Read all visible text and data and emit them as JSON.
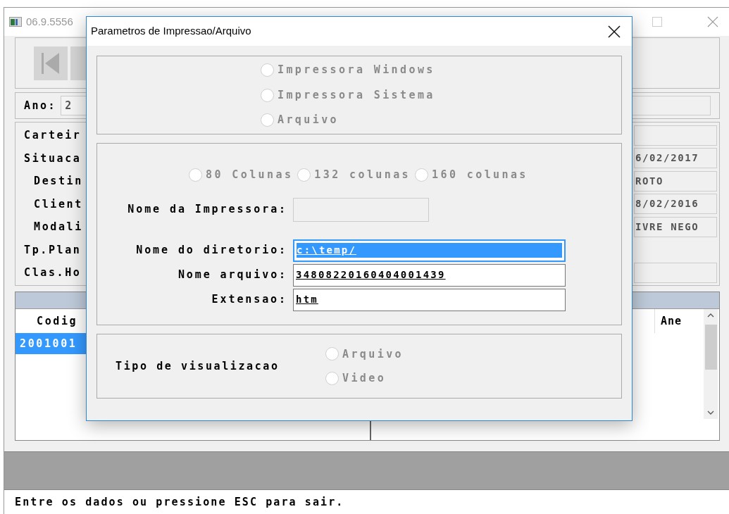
{
  "window": {
    "title": "06.9.5556"
  },
  "year": {
    "label": "Ano:",
    "value": "2"
  },
  "info_rows": [
    {
      "label": "Carteir",
      "field": true
    },
    {
      "label": "Situaca",
      "field": true,
      "value": "6/02/2017"
    },
    {
      "label": "Destin",
      "field": true,
      "value": "ROTO"
    },
    {
      "label": "Client",
      "field": true,
      "value": "8/02/2016"
    },
    {
      "label": "Modali",
      "field": true,
      "value": "IVRE NEGO"
    },
    {
      "label": "Tp.Plan",
      "field": false
    },
    {
      "label": "Clas.Ho",
      "field": true
    }
  ],
  "table": {
    "columns": [
      "Codig",
      "Ane"
    ],
    "rows": [
      {
        "cells": [
          "2001001"
        ],
        "selected": true
      }
    ]
  },
  "status_bar": "Entre os dados ou pressione ESC para sair.",
  "dialog": {
    "title": "Parametros de Impressao/Arquivo",
    "destination": [
      {
        "label": "Impressora Windows",
        "selected": false,
        "disabled": true
      },
      {
        "label": "Impressora Sistema",
        "selected": false,
        "disabled": true
      },
      {
        "label": "Arquivo",
        "selected": false,
        "disabled": true
      }
    ],
    "columns": [
      {
        "label": "80 Colunas",
        "selected": false,
        "disabled": true
      },
      {
        "label": "132 colunas",
        "selected": false,
        "disabled": true
      },
      {
        "label": "160 colunas",
        "selected": false,
        "disabled": true
      }
    ],
    "fields": [
      {
        "label": "Nome da Impressora:",
        "kind": "short",
        "disabled": true,
        "selected": false
      },
      {
        "label": "Nome do diretorio:",
        "kind": "long",
        "value": "c:\\temp/",
        "disabled": false,
        "selected": true
      },
      {
        "label": "Nome arquivo:",
        "kind": "long",
        "value": "34808220160404001439",
        "disabled": false,
        "selected": false
      },
      {
        "label": "Extensao:",
        "kind": "long",
        "value": "htm",
        "disabled": false,
        "selected": false
      }
    ],
    "view": {
      "label": "Tipo de visualizacao",
      "options": [
        {
          "label": "Arquivo",
          "selected": false,
          "disabled": true
        },
        {
          "label": "Video",
          "selected": false,
          "disabled": true
        }
      ]
    }
  }
}
